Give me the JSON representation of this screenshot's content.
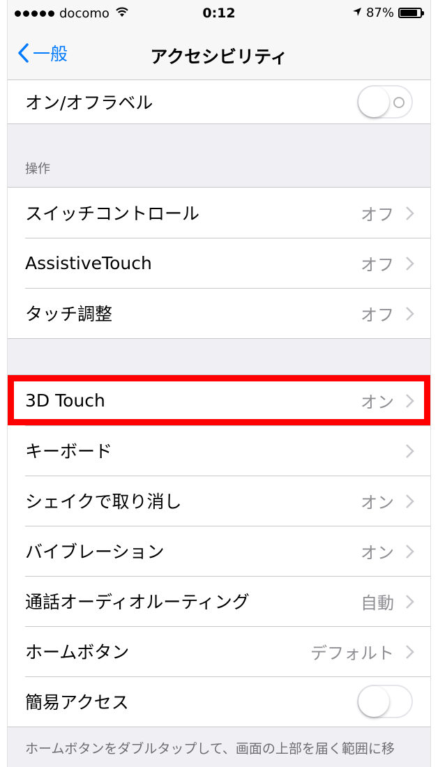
{
  "status_bar": {
    "carrier": "docomo",
    "time": "0:12",
    "battery_percent": "87%",
    "battery_level": 0.87,
    "icons": [
      "signal-dots",
      "wifi-icon",
      "location-arrow-icon",
      "battery-icon"
    ]
  },
  "nav": {
    "back_label": "一般",
    "title": "アクセシビリティ"
  },
  "top_group": {
    "items": [
      {
        "label": "オン/オフラベル",
        "control": "toggle-off"
      }
    ]
  },
  "section_control": {
    "header": "操作",
    "items": [
      {
        "label": "スイッチコントロール",
        "value": "オフ"
      },
      {
        "label": "AssistiveTouch",
        "value": "オフ"
      },
      {
        "label": "タッチ調整",
        "value": "オフ"
      }
    ]
  },
  "section_touch": {
    "items": [
      {
        "label": "3D Touch",
        "value": "オン",
        "highlighted": true
      },
      {
        "label": "キーボード",
        "value": ""
      },
      {
        "label": "シェイクで取り消し",
        "value": "オン"
      },
      {
        "label": "バイブレーション",
        "value": "オン"
      },
      {
        "label": "通話オーディオルーティング",
        "value": "自動"
      },
      {
        "label": "ホームボタン",
        "value": "デフォルト"
      },
      {
        "label": "簡易アクセス",
        "control": "toggle-off"
      }
    ],
    "footer": "ホームボタンをダブルタップして、画面の上部を届く範囲に移"
  },
  "colors": {
    "accent": "#007aff",
    "highlight": "#ff0000",
    "background": "#efeff4",
    "secondary_text": "#8e8e93"
  }
}
